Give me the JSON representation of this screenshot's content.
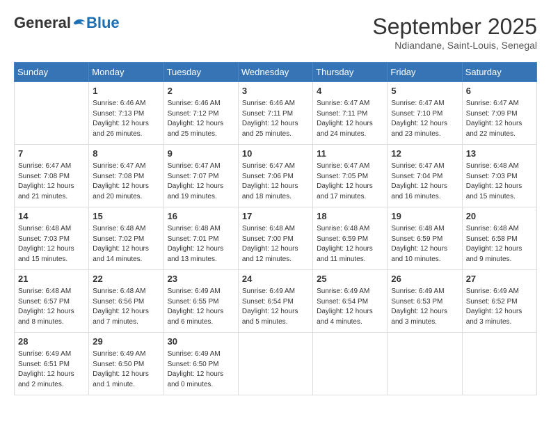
{
  "logo": {
    "general": "General",
    "blue": "Blue"
  },
  "header": {
    "month": "September 2025",
    "location": "Ndiandane, Saint-Louis, Senegal"
  },
  "weekdays": [
    "Sunday",
    "Monday",
    "Tuesday",
    "Wednesday",
    "Thursday",
    "Friday",
    "Saturday"
  ],
  "weeks": [
    [
      {
        "day": "",
        "info": ""
      },
      {
        "day": "1",
        "info": "Sunrise: 6:46 AM\nSunset: 7:13 PM\nDaylight: 12 hours\nand 26 minutes."
      },
      {
        "day": "2",
        "info": "Sunrise: 6:46 AM\nSunset: 7:12 PM\nDaylight: 12 hours\nand 25 minutes."
      },
      {
        "day": "3",
        "info": "Sunrise: 6:46 AM\nSunset: 7:11 PM\nDaylight: 12 hours\nand 25 minutes."
      },
      {
        "day": "4",
        "info": "Sunrise: 6:47 AM\nSunset: 7:11 PM\nDaylight: 12 hours\nand 24 minutes."
      },
      {
        "day": "5",
        "info": "Sunrise: 6:47 AM\nSunset: 7:10 PM\nDaylight: 12 hours\nand 23 minutes."
      },
      {
        "day": "6",
        "info": "Sunrise: 6:47 AM\nSunset: 7:09 PM\nDaylight: 12 hours\nand 22 minutes."
      }
    ],
    [
      {
        "day": "7",
        "info": "Sunrise: 6:47 AM\nSunset: 7:08 PM\nDaylight: 12 hours\nand 21 minutes."
      },
      {
        "day": "8",
        "info": "Sunrise: 6:47 AM\nSunset: 7:08 PM\nDaylight: 12 hours\nand 20 minutes."
      },
      {
        "day": "9",
        "info": "Sunrise: 6:47 AM\nSunset: 7:07 PM\nDaylight: 12 hours\nand 19 minutes."
      },
      {
        "day": "10",
        "info": "Sunrise: 6:47 AM\nSunset: 7:06 PM\nDaylight: 12 hours\nand 18 minutes."
      },
      {
        "day": "11",
        "info": "Sunrise: 6:47 AM\nSunset: 7:05 PM\nDaylight: 12 hours\nand 17 minutes."
      },
      {
        "day": "12",
        "info": "Sunrise: 6:47 AM\nSunset: 7:04 PM\nDaylight: 12 hours\nand 16 minutes."
      },
      {
        "day": "13",
        "info": "Sunrise: 6:48 AM\nSunset: 7:03 PM\nDaylight: 12 hours\nand 15 minutes."
      }
    ],
    [
      {
        "day": "14",
        "info": "Sunrise: 6:48 AM\nSunset: 7:03 PM\nDaylight: 12 hours\nand 15 minutes."
      },
      {
        "day": "15",
        "info": "Sunrise: 6:48 AM\nSunset: 7:02 PM\nDaylight: 12 hours\nand 14 minutes."
      },
      {
        "day": "16",
        "info": "Sunrise: 6:48 AM\nSunset: 7:01 PM\nDaylight: 12 hours\nand 13 minutes."
      },
      {
        "day": "17",
        "info": "Sunrise: 6:48 AM\nSunset: 7:00 PM\nDaylight: 12 hours\nand 12 minutes."
      },
      {
        "day": "18",
        "info": "Sunrise: 6:48 AM\nSunset: 6:59 PM\nDaylight: 12 hours\nand 11 minutes."
      },
      {
        "day": "19",
        "info": "Sunrise: 6:48 AM\nSunset: 6:59 PM\nDaylight: 12 hours\nand 10 minutes."
      },
      {
        "day": "20",
        "info": "Sunrise: 6:48 AM\nSunset: 6:58 PM\nDaylight: 12 hours\nand 9 minutes."
      }
    ],
    [
      {
        "day": "21",
        "info": "Sunrise: 6:48 AM\nSunset: 6:57 PM\nDaylight: 12 hours\nand 8 minutes."
      },
      {
        "day": "22",
        "info": "Sunrise: 6:48 AM\nSunset: 6:56 PM\nDaylight: 12 hours\nand 7 minutes."
      },
      {
        "day": "23",
        "info": "Sunrise: 6:49 AM\nSunset: 6:55 PM\nDaylight: 12 hours\nand 6 minutes."
      },
      {
        "day": "24",
        "info": "Sunrise: 6:49 AM\nSunset: 6:54 PM\nDaylight: 12 hours\nand 5 minutes."
      },
      {
        "day": "25",
        "info": "Sunrise: 6:49 AM\nSunset: 6:54 PM\nDaylight: 12 hours\nand 4 minutes."
      },
      {
        "day": "26",
        "info": "Sunrise: 6:49 AM\nSunset: 6:53 PM\nDaylight: 12 hours\nand 3 minutes."
      },
      {
        "day": "27",
        "info": "Sunrise: 6:49 AM\nSunset: 6:52 PM\nDaylight: 12 hours\nand 3 minutes."
      }
    ],
    [
      {
        "day": "28",
        "info": "Sunrise: 6:49 AM\nSunset: 6:51 PM\nDaylight: 12 hours\nand 2 minutes."
      },
      {
        "day": "29",
        "info": "Sunrise: 6:49 AM\nSunset: 6:50 PM\nDaylight: 12 hours\nand 1 minute."
      },
      {
        "day": "30",
        "info": "Sunrise: 6:49 AM\nSunset: 6:50 PM\nDaylight: 12 hours\nand 0 minutes."
      },
      {
        "day": "",
        "info": ""
      },
      {
        "day": "",
        "info": ""
      },
      {
        "day": "",
        "info": ""
      },
      {
        "day": "",
        "info": ""
      }
    ]
  ]
}
